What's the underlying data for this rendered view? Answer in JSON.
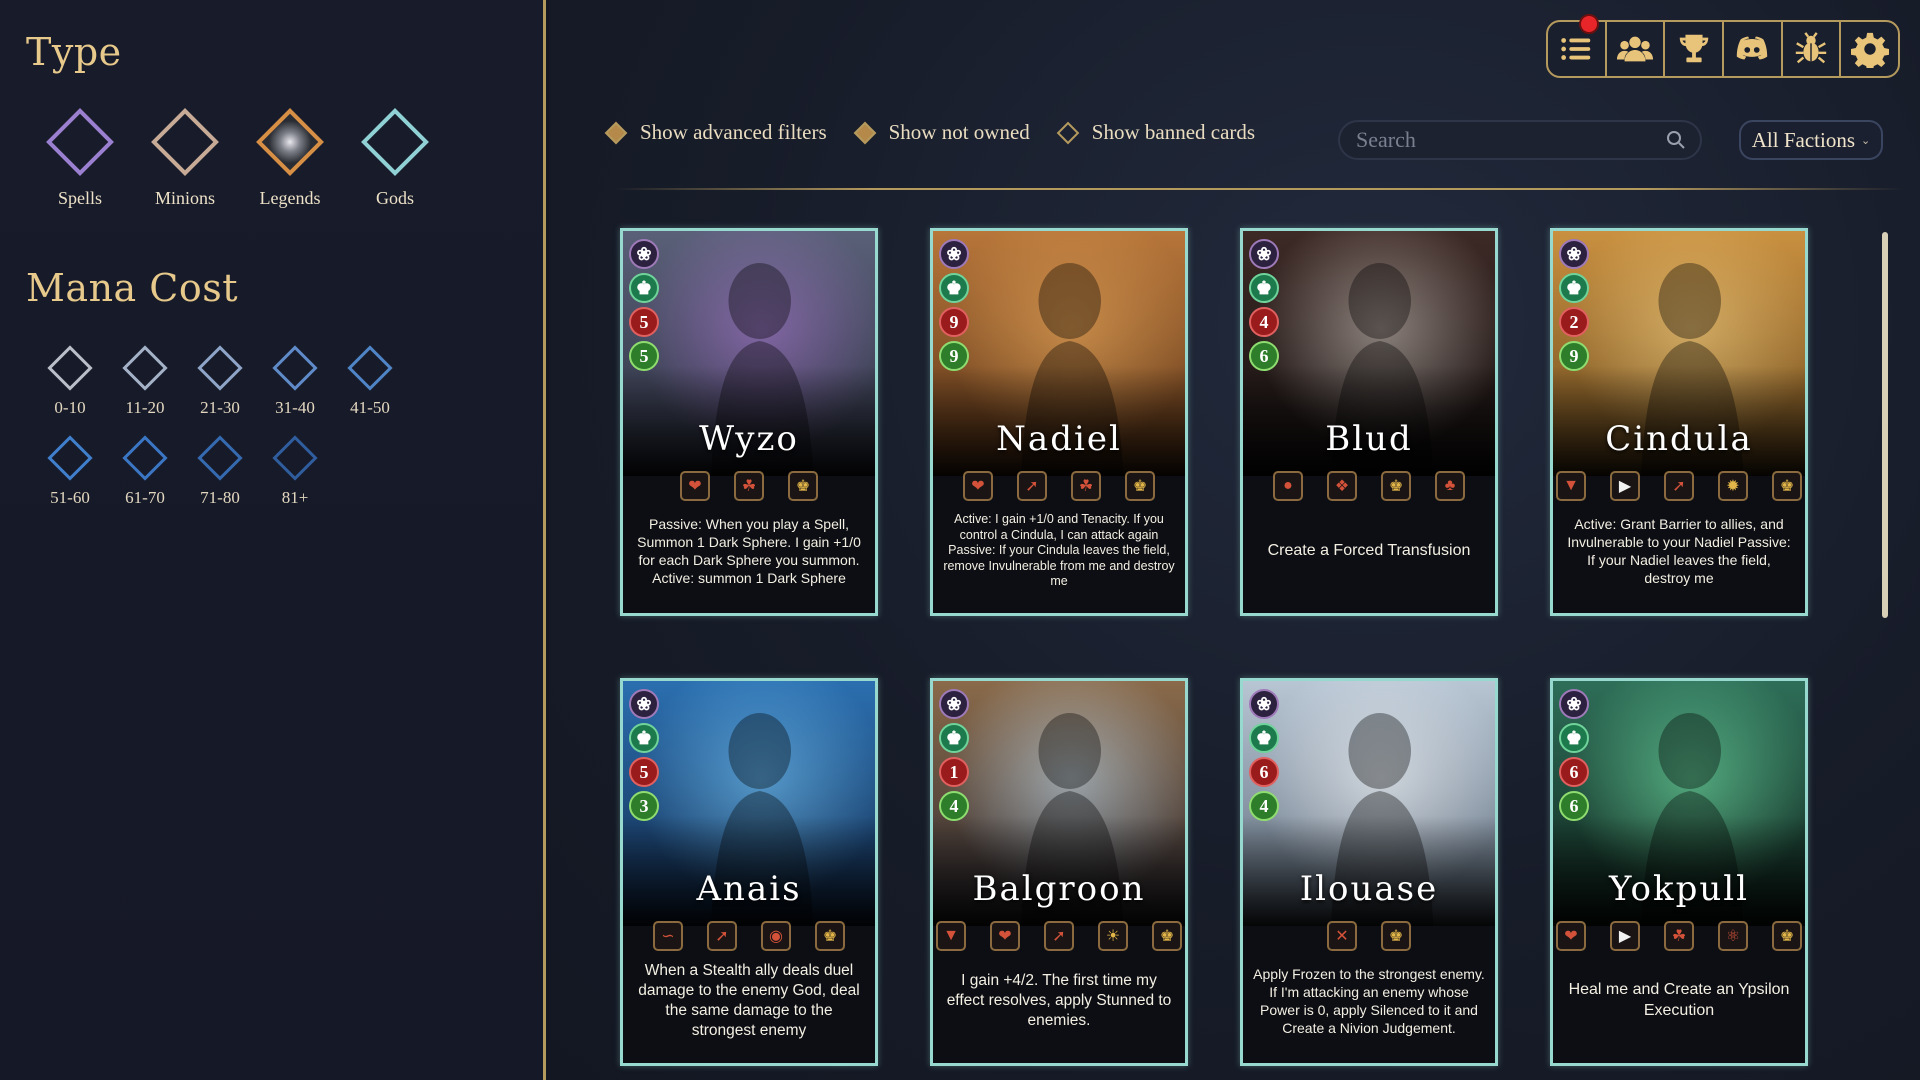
{
  "sidebar": {
    "type_title": "Type",
    "types": [
      {
        "label": "Spells",
        "color": "#9b7fd0"
      },
      {
        "label": "Minions",
        "color": "#c7ab96"
      },
      {
        "label": "Legends",
        "color": "#d68f45"
      },
      {
        "label": "Gods",
        "color": "#8fd1d4"
      }
    ],
    "mana_title": "Mana Cost",
    "mana_ranges": [
      "0-10",
      "11-20",
      "21-30",
      "31-40",
      "41-50",
      "51-60",
      "61-70",
      "71-80",
      "81+"
    ]
  },
  "nav": {
    "icons": [
      "list-icon",
      "players-icon",
      "trophy-icon",
      "discord-icon",
      "bug-icon",
      "gear-icon"
    ],
    "has_notification": true
  },
  "filters": {
    "advanced": "Show advanced filters",
    "not_owned": "Show not owned",
    "banned": "Show banned cards",
    "search_placeholder": "Search",
    "faction": "All Factions"
  },
  "colors": {
    "accent_gold": "#b59a5e",
    "card_border": "#97d8cf",
    "keyword_yellow": "#f2d53c",
    "keyword_cyan": "#5fd3f0"
  },
  "cards": [
    {
      "name": "Wyzo",
      "atk": "5",
      "hp": "5",
      "desc": "Passive: When you play a Spell, Summon 1 Dark Sphere. I gain +1/0 for each Dark Sphere you summon. Active: summon 1 Dark Sphere"
    },
    {
      "name": "Nadiel",
      "atk": "9",
      "hp": "9",
      "desc": "Active: I gain +1/0 and Tenacity. If you control a Cindula, I can attack again Passive: If your Cindula leaves the field, remove Invulnerable from me and destroy me"
    },
    {
      "name": "Blud",
      "atk": "4",
      "hp": "6",
      "desc": "Create a Forced Transfusion"
    },
    {
      "name": "Cindula",
      "atk": "2",
      "hp": "9",
      "desc": "Active: Grant Barrier to allies, and Invulnerable to your Nadiel Passive: If your Nadiel leaves the field, destroy me"
    },
    {
      "name": "Anais",
      "atk": "5",
      "hp": "3",
      "desc": "When a Stealth ally deals duel damage to the enemy God, deal the same damage to the strongest enemy"
    },
    {
      "name": "Balgroon",
      "atk": "1",
      "hp": "4",
      "desc": "I gain +4/2. The first time my effect resolves, apply Stunned to enemies."
    },
    {
      "name": "Ilouase",
      "atk": "6",
      "hp": "4",
      "desc": "Apply Frozen to the strongest enemy. If I'm attacking an enemy whose Power is 0, apply Silenced to it and Create a Nivion Judgement."
    },
    {
      "name": "Yokpull",
      "atk": "6",
      "hp": "6",
      "desc": "Heal me and Create an Ypsilon Execution"
    }
  ]
}
